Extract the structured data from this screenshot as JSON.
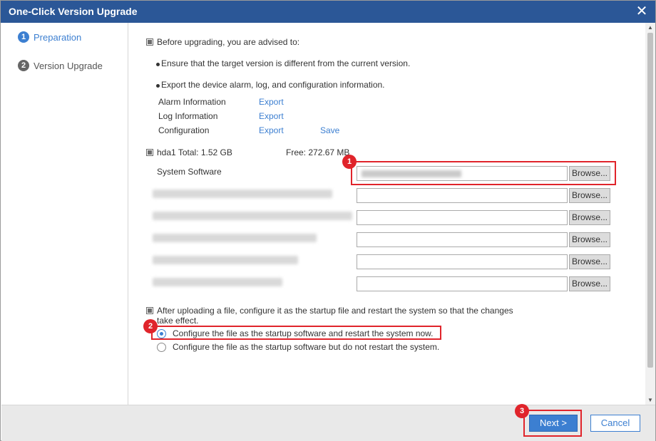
{
  "window": {
    "title": "One-Click Version Upgrade"
  },
  "steps": [
    {
      "num": "1",
      "label": "Preparation"
    },
    {
      "num": "2",
      "label": "Version Upgrade"
    }
  ],
  "advice": {
    "heading": "Before upgrading, you are advised to:",
    "bullets": [
      "Ensure that the target version is different from the current version.",
      "Export the device alarm, log, and configuration information."
    ]
  },
  "exports": [
    {
      "label": "Alarm Information",
      "action": "Export"
    },
    {
      "label": "Log Information",
      "action": "Export"
    },
    {
      "label": "Configuration",
      "action": "Export",
      "extra": "Save"
    }
  ],
  "storage": {
    "total": "hda1 Total: 1.52 GB",
    "free": "Free: 272.67 MB"
  },
  "files": {
    "system_label": "System Software",
    "browse_label": "Browse..."
  },
  "restart": {
    "text_line1": "After uploading a file, configure it as the startup file and restart the system so that the changes",
    "text_line2": "take effect.",
    "option_restart": "Configure the file as the startup software and restart the system now.",
    "option_no_restart": "Configure the file as the startup software but do not restart the system.",
    "selected": "option_restart"
  },
  "annotations": [
    "1",
    "2",
    "3"
  ],
  "footer": {
    "next_label": "Next >",
    "cancel_label": "Cancel"
  },
  "colors": {
    "titlebar": "#2b5797",
    "accent": "#3c7fd1",
    "annotation": "#e0242b"
  }
}
